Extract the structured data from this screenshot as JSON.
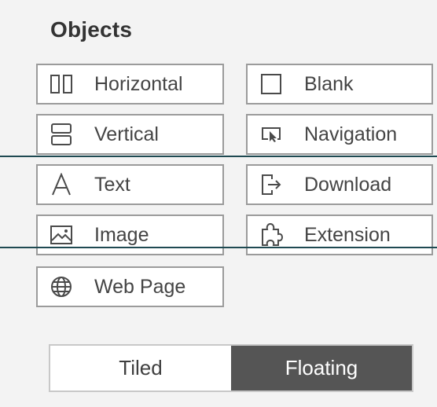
{
  "objects_panel": {
    "title": "Objects",
    "items": [
      {
        "label": "Horizontal",
        "icon": "horizontal-layout-icon"
      },
      {
        "label": "Blank",
        "icon": "blank-icon"
      },
      {
        "label": "Vertical",
        "icon": "vertical-layout-icon"
      },
      {
        "label": "Navigation",
        "icon": "navigation-icon"
      },
      {
        "label": "Text",
        "icon": "text-icon"
      },
      {
        "label": "Download",
        "icon": "download-icon"
      },
      {
        "label": "Image",
        "icon": "image-icon"
      },
      {
        "label": "Extension",
        "icon": "extension-puzzle-icon"
      },
      {
        "label": "Web Page",
        "icon": "web-page-globe-icon"
      }
    ]
  },
  "layout_toggle": {
    "options": [
      "Tiled",
      "Floating"
    ],
    "selected": "Floating"
  },
  "colors": {
    "panel_background": "#f3f3f3",
    "item_border": "#9b9b9b",
    "selected_segment": "#555555",
    "overlay_line": "#1f4a52"
  }
}
